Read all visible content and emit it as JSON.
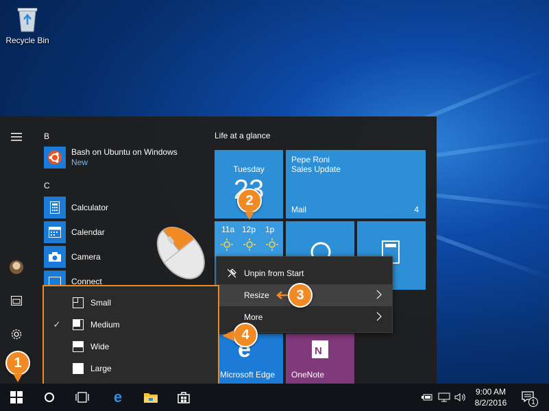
{
  "desktop": {
    "recycle_bin_label": "Recycle Bin"
  },
  "start_menu": {
    "sections": {
      "b": "B",
      "c": "C"
    },
    "apps": [
      {
        "name": "Bash on Ubuntu on Windows",
        "sub": "New",
        "icon": "ubuntu-icon"
      },
      {
        "name": "Calculator",
        "icon": "calculator-icon"
      },
      {
        "name": "Calendar",
        "icon": "calendar-icon"
      },
      {
        "name": "Camera",
        "icon": "camera-icon"
      },
      {
        "name": "Connect",
        "icon": "connect-icon"
      }
    ],
    "group_title": "Life at a glance",
    "tiles": {
      "calendar": {
        "day": "Tuesday",
        "date": "23"
      },
      "mail": {
        "sender": "Pepe Roni",
        "subject": "Sales Update",
        "label": "Mail",
        "count": "4"
      },
      "weather": {
        "hours": [
          "11a",
          "12p",
          "1p"
        ]
      },
      "edge": {
        "label": "Microsoft Edge"
      },
      "onenote": {
        "label": "OneNote"
      }
    },
    "context_menu": {
      "unpin": "Unpin from Start",
      "resize": "Resize",
      "more": "More"
    },
    "resize_menu": {
      "small": "Small",
      "medium": "Medium",
      "wide": "Wide",
      "large": "Large",
      "selected": "Medium"
    }
  },
  "taskbar": {
    "time": "9:00 AM",
    "date": "8/2/2016",
    "notification_count": "1"
  },
  "callouts": [
    "1",
    "2",
    "3",
    "4"
  ],
  "colors": {
    "accent": "#1c7bd6",
    "tile_blue": "#2d8fd5",
    "onenote": "#80397b",
    "callout": "#f08a24"
  }
}
